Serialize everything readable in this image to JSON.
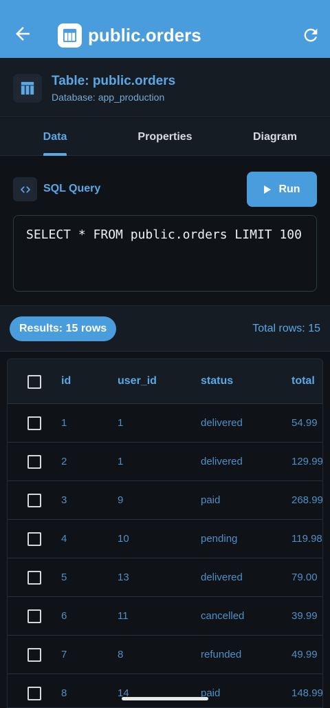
{
  "appbar": {
    "title": "public.orders"
  },
  "table_header": {
    "title": "Table: public.orders",
    "subtitle": "Database: app_production"
  },
  "tabs": [
    {
      "label": "Data",
      "active": true
    },
    {
      "label": "Properties",
      "active": false
    },
    {
      "label": "Diagram",
      "active": false
    }
  ],
  "query": {
    "label": "SQL Query",
    "run_label": "Run",
    "sql": "SELECT * FROM public.orders LIMIT 100"
  },
  "results": {
    "pill": "Results: 15 rows",
    "total": "Total rows: 15"
  },
  "grid": {
    "columns": [
      "id",
      "user_id",
      "status",
      "total"
    ],
    "rows": [
      [
        "1",
        "1",
        "delivered",
        "54.99"
      ],
      [
        "2",
        "1",
        "delivered",
        "129.99"
      ],
      [
        "3",
        "9",
        "paid",
        "268.99"
      ],
      [
        "4",
        "10",
        "pending",
        "119.98"
      ],
      [
        "5",
        "13",
        "delivered",
        "79.00"
      ],
      [
        "6",
        "11",
        "cancelled",
        "39.99"
      ],
      [
        "7",
        "8",
        "refunded",
        "49.99"
      ],
      [
        "8",
        "14",
        "paid",
        "148.99"
      ]
    ]
  },
  "colors": {
    "primary": "#4a9ddc",
    "accent_text": "#5aa8e6",
    "background": "#0f1318",
    "surface": "#161c23"
  },
  "icons": {
    "back": "arrow-left-icon",
    "table": "table-icon",
    "refresh": "refresh-icon",
    "code": "code-icon",
    "play": "play-icon"
  }
}
